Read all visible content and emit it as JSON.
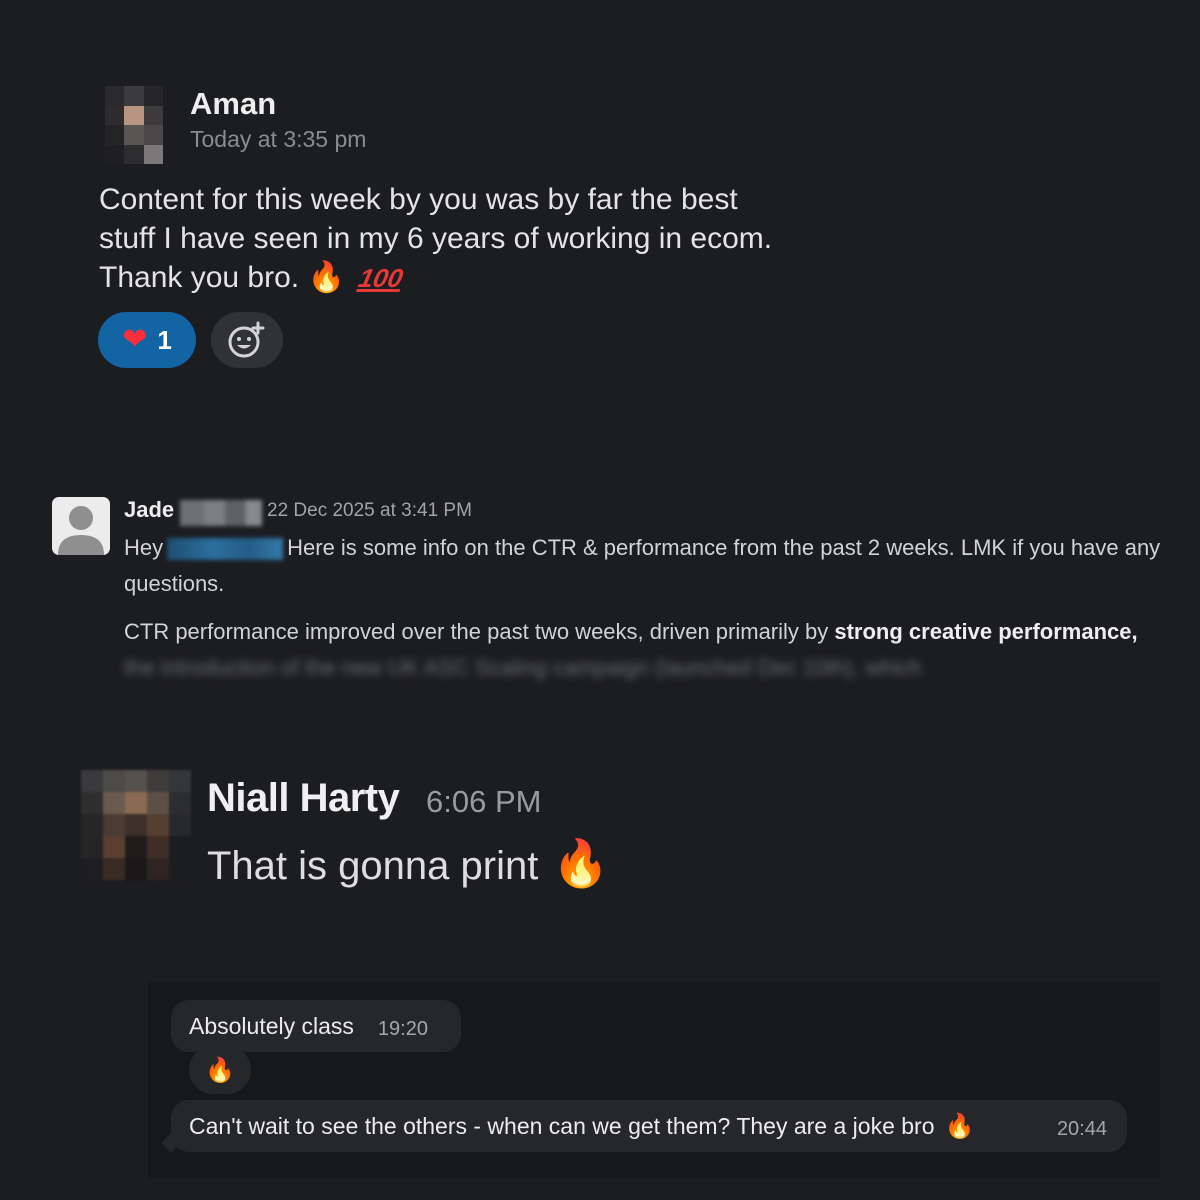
{
  "messages": {
    "aman": {
      "name": "Aman",
      "time": "Today at 3:35 pm",
      "text": "Content for this week by you was by far the best stuff I have seen in my 6 years of working in ecom. Thank you bro.",
      "text_emoji_1": "🔥",
      "text_emoji_2": "100",
      "reaction": {
        "emoji": "❤",
        "count": "1"
      },
      "add_reaction_icon": "add-emoji-icon"
    },
    "jade": {
      "name": "Jade",
      "time": "22 Dec 2025 at 3:41 PM",
      "p1_start": "Hey",
      "p1_rest": "Here is some info on the CTR & performance from the past 2 weeks. LMK if you have any questions.",
      "p2_start": "CTR performance improved over the past two weeks, driven primarily by ",
      "p2_bold": "strong creative performance,",
      "p2_redacted": "the introduction of the new UK ASC Scaling campaign (launched Dec 10th), which"
    },
    "niall": {
      "name": "Niall Harty",
      "time": "6:06 PM",
      "text": "That is gonna print",
      "emoji": "🔥"
    }
  },
  "chat": {
    "bubble1": {
      "text": "Absolutely class",
      "time": "19:20"
    },
    "bubble1_reaction": "🔥",
    "bubble2": {
      "text": "Can't wait to see the others - when can we get them? They are a joke bro",
      "emoji": "🔥",
      "time": "20:44"
    }
  },
  "colors": {
    "background": "#1c1d21",
    "reaction_active": "#1264a3",
    "bubble": "#26272b"
  }
}
